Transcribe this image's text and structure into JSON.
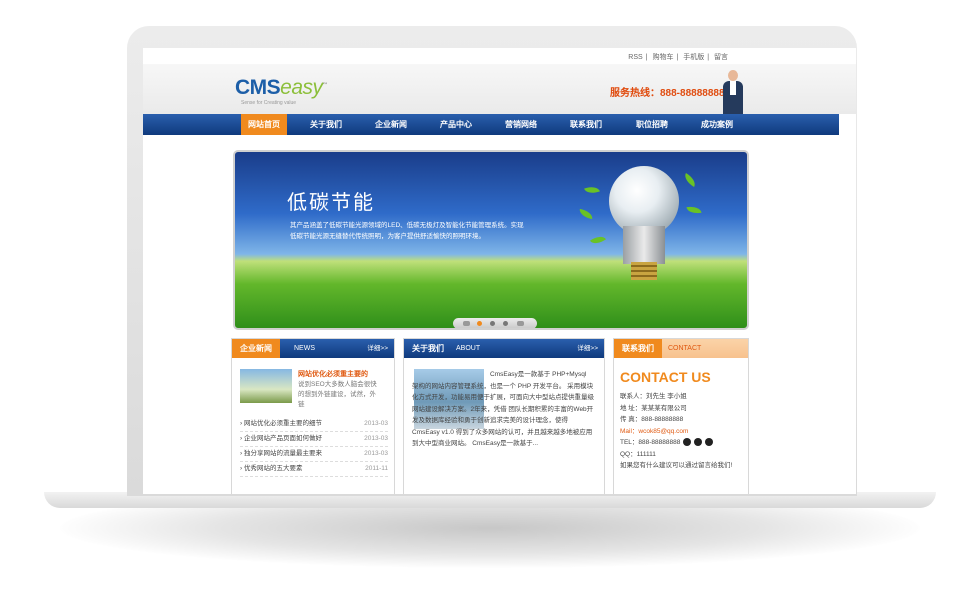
{
  "topbar": {
    "links": [
      "RSS",
      "购物车",
      "手机版",
      "留言"
    ]
  },
  "header": {
    "logo_main": "CMS",
    "logo_accent": "easy",
    "logo_tm": "™",
    "slogan": "Sense for Creating value",
    "hotline": "服务热线：888-88888888"
  },
  "nav": {
    "items": [
      "网站首页",
      "关于我们",
      "企业新闻",
      "产品中心",
      "营销网络",
      "联系我们",
      "职位招聘",
      "成功案例"
    ],
    "active_index": 0
  },
  "banner": {
    "title": "低碳节能",
    "desc": "其产品涵盖了低碳节能光源领域的LED、低碳无极灯及智能化节能管理系统。实现低碳节能光源无缝替代传统照明，为客户提供舒适愉快的照明环境。",
    "slide_count": 4,
    "active_slide": 0
  },
  "news": {
    "tag": "企业新闻",
    "en": "NEWS",
    "more": "详细>>",
    "featured_title": "网站优化必须重主要的",
    "featured_desc": "说到SEO大多数人脑会很快的想到外链建设，试然，外链",
    "items": [
      {
        "title": "网站优化必须重主要的细节",
        "date": "2013-03"
      },
      {
        "title": "企业网站产品页面如何做好",
        "date": "2013-03"
      },
      {
        "title": "独分享网站的流量最主要来",
        "date": "2013-03"
      },
      {
        "title": "优秀网站的五大要素",
        "date": "2011-11"
      }
    ]
  },
  "about": {
    "tag": "关于我们",
    "en": "ABOUT",
    "more": "详细>>",
    "text": "CmsEasy是一款基于 PHP+Mysql 架构的网站内容管理系统，也是一个 PHP 开发平台。 采用模块化方式开发，功能易用便于扩展，可面向大中型站点提供重量级网站建设解决方案。2年来，凭借 团队长期积累的丰富的Web开发及数据库经验和勇于创新追求完美的设计理念，使得 CmsEasy v1.0 得到了众多网站的认可，并且越来越多地被应用到大中型商业网站。 CmsEasy是一款基于..."
  },
  "contact": {
    "tag": "联系我们",
    "en": "CONTACT",
    "big": "CONTACT US",
    "lines": [
      "联系人：刘先生 李小姐",
      "地 址：某某某有限公司",
      "传 真：888-88888888",
      "Mail：wcok85@qq.com",
      "TEL：888-88888888",
      "QQ：111111",
      "如果您有什么建议可以通过留言给我们!"
    ]
  }
}
